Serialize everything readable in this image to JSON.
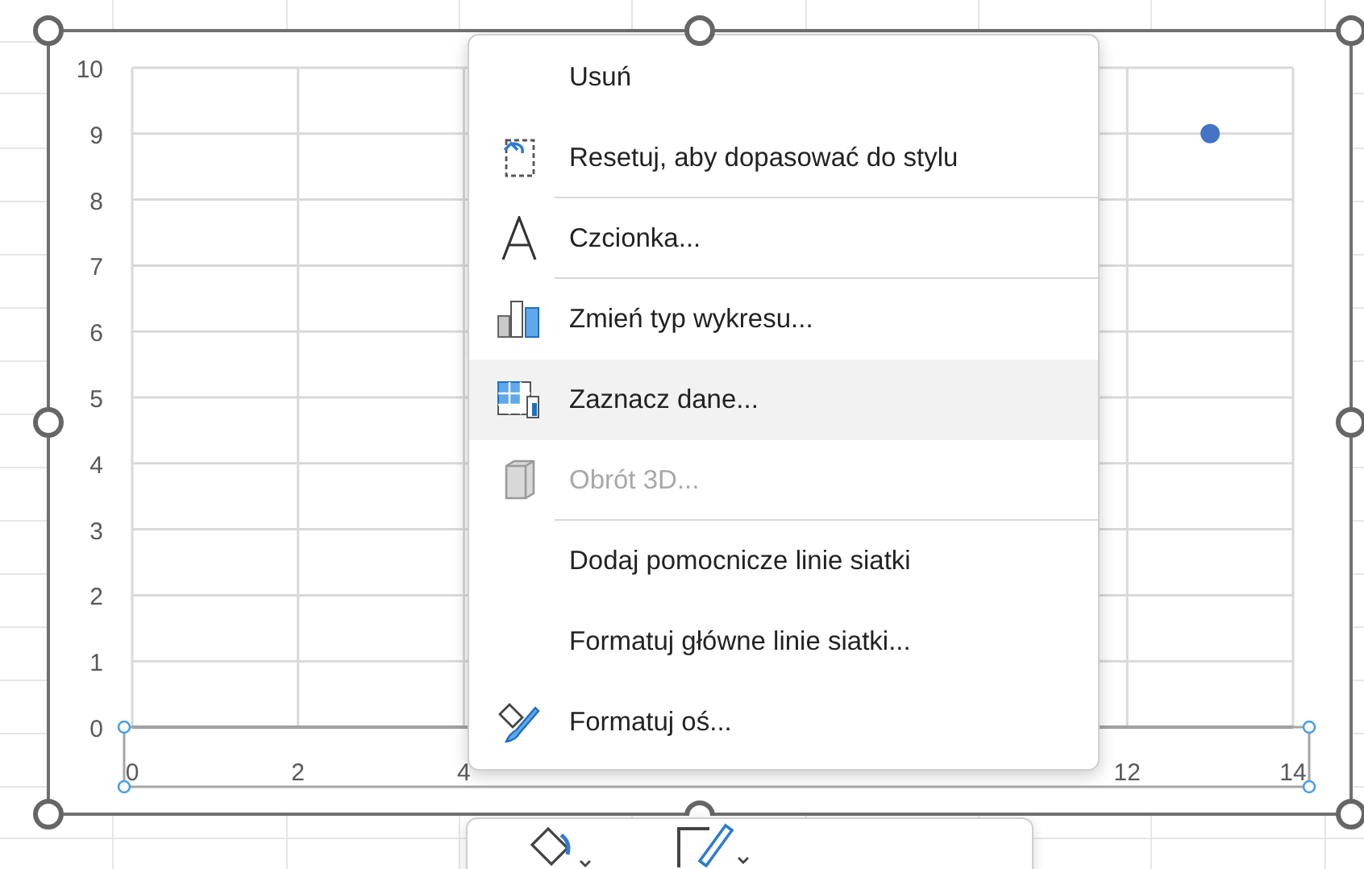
{
  "chart": {
    "chart_data": {
      "type": "scatter",
      "grid": true,
      "x": [
        13
      ],
      "series": [
        {
          "color": "#4472c4",
          "values": [
            9
          ]
        }
      ],
      "xlim": [
        0,
        14
      ],
      "ylim": [
        0,
        10
      ],
      "xticks": [
        0,
        2,
        4,
        12,
        14
      ],
      "yticks": [
        0,
        1,
        2,
        3,
        4,
        5,
        6,
        7,
        8,
        9,
        10
      ]
    }
  },
  "context_menu": {
    "items": [
      {
        "kind": "plain",
        "label": "Usuń",
        "disabled": false,
        "highlighted": false
      },
      {
        "kind": "reset",
        "label": "Resetuj, aby dopasować do stylu",
        "disabled": false,
        "highlighted": false
      },
      {
        "kind": "separator"
      },
      {
        "kind": "font",
        "label": "Czcionka...",
        "disabled": false,
        "highlighted": false
      },
      {
        "kind": "separator"
      },
      {
        "kind": "charttype",
        "label": "Zmień typ wykresu...",
        "disabled": false,
        "highlighted": false
      },
      {
        "kind": "selectdata",
        "label": "Zaznacz dane...",
        "disabled": false,
        "highlighted": true
      },
      {
        "kind": "rotate",
        "label": "Obrót 3D...",
        "disabled": true,
        "highlighted": false
      },
      {
        "kind": "separator"
      },
      {
        "kind": "plain",
        "label": "Dodaj pomocnicze linie siatki",
        "disabled": false,
        "highlighted": false
      },
      {
        "kind": "plain",
        "label": "Formatuj główne linie siatki...",
        "disabled": false,
        "highlighted": false
      },
      {
        "kind": "formataxis",
        "label": "Formatuj oś...",
        "disabled": false,
        "highlighted": false
      }
    ]
  }
}
